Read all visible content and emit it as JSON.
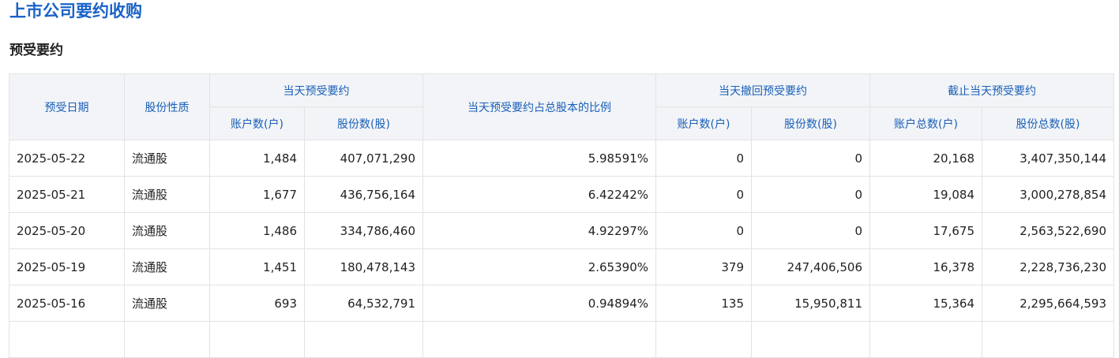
{
  "page_title": "上市公司要约收购",
  "section_title": "预受要约",
  "headers": {
    "date": "预受日期",
    "share_type": "股份性质",
    "group_today": "当天预受要约",
    "ratio": "当天预受要约占总股本的比例",
    "group_withdraw": "当天撤回预受要约",
    "group_cumulative": "截止当天预受要约",
    "today_accounts": "账户数(户)",
    "today_shares": "股份数(股)",
    "withdraw_accounts": "账户数(户)",
    "withdraw_shares": "股份数(股)",
    "cum_accounts": "账户总数(户)",
    "cum_shares": "股份总数(股)"
  },
  "rows": [
    [
      "2025-05-22",
      "流通股",
      "1,484",
      "407,071,290",
      "5.98591%",
      "0",
      "0",
      "20,168",
      "3,407,350,144"
    ],
    [
      "2025-05-21",
      "流通股",
      "1,677",
      "436,756,164",
      "6.42242%",
      "0",
      "0",
      "19,084",
      "3,000,278,854"
    ],
    [
      "2025-05-20",
      "流通股",
      "1,486",
      "334,786,460",
      "4.92297%",
      "0",
      "0",
      "17,675",
      "2,563,522,690"
    ],
    [
      "2025-05-19",
      "流通股",
      "1,451",
      "180,478,143",
      "2.65390%",
      "379",
      "247,406,506",
      "16,378",
      "2,228,736,230"
    ],
    [
      "2025-05-16",
      "流通股",
      "693",
      "64,532,791",
      "0.94894%",
      "135",
      "15,950,811",
      "15,364",
      "2,295,664,593"
    ]
  ]
}
